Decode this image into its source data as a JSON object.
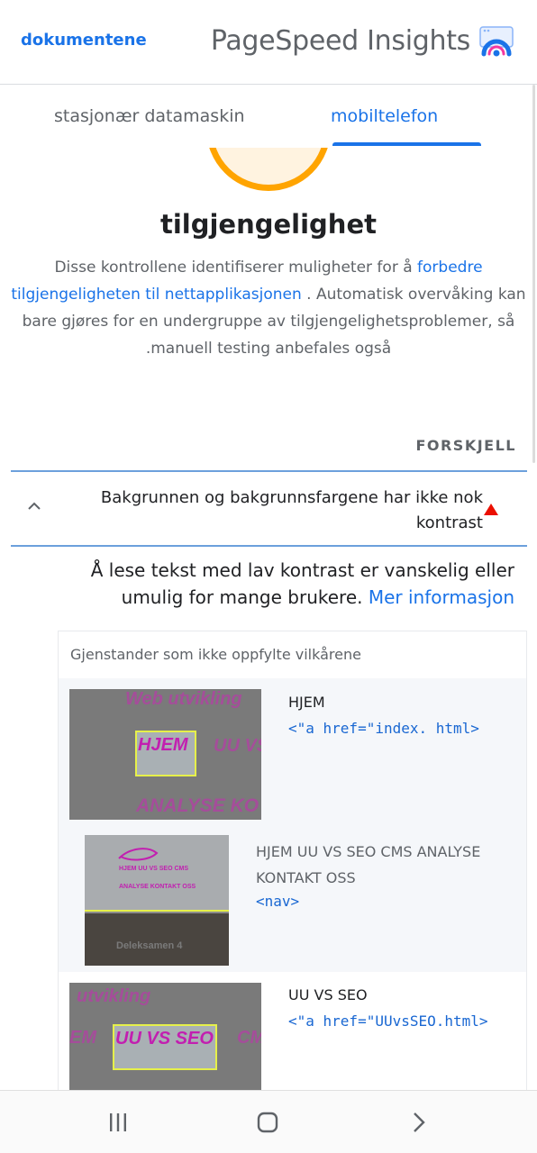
{
  "header": {
    "docs_link": "dokumentene",
    "brand": "PageSpeed Insights"
  },
  "tabs": {
    "desktop": "stasjonær datamaskin",
    "mobile": "mobiltelefon"
  },
  "category": {
    "title": "tilgjengelighet",
    "desc_part1": "Disse kontrollene identifiserer muligheter for å ",
    "desc_link": "forbedre tilgjengeligheten til nettapplikasjonen",
    "desc_part2": " . Automatisk overvåking kan bare gjøres for en undergruppe av tilgjengelighetsproblemer, så .manuell testing anbefales også"
  },
  "diff_label": "FORSKJELL",
  "audit": {
    "title": "Bakgrunnen og bakgrunnsfargene har ikke nok kontrast",
    "desc_text": "Å lese tekst med lav kontrast er vanskelig eller umulig for mange brukere.",
    "desc_link": "Mer informasjon"
  },
  "table": {
    "heading": "Gjenstander som ikke oppfylte vilkårene",
    "rows": [
      {
        "label": "HJEM",
        "code": "<\"a href=\"index. html>",
        "thumb_highlight": "HJEM",
        "thumb_top": "Web utvikling",
        "thumb_right": "UU VS",
        "thumb_bottom": "ANALYSE KO"
      },
      {
        "label": "HJEM UU VS SEO CMS ANALYSE KONTAKT OSS",
        "code": "<nav>",
        "thumb_line1": "HJEM    UU VS SEO    CMS",
        "thumb_line2": "ANALYSE    KONTAKT OSS",
        "thumb_caption": "Deleksamen 4"
      },
      {
        "label": "UU VS SEO",
        "code": "<\"a href=\"UUvsSEO.html>",
        "thumb_highlight": "UU VS SEO",
        "thumb_top": "utvikling",
        "thumb_left": "EM",
        "thumb_right": "CM"
      }
    ]
  },
  "navbar": {
    "recent": "recent-apps-icon",
    "home": "home-icon",
    "back": "back-icon"
  },
  "colors": {
    "accent": "#1a73e8",
    "average": "#ffa400",
    "fail": "#eb0f00"
  }
}
